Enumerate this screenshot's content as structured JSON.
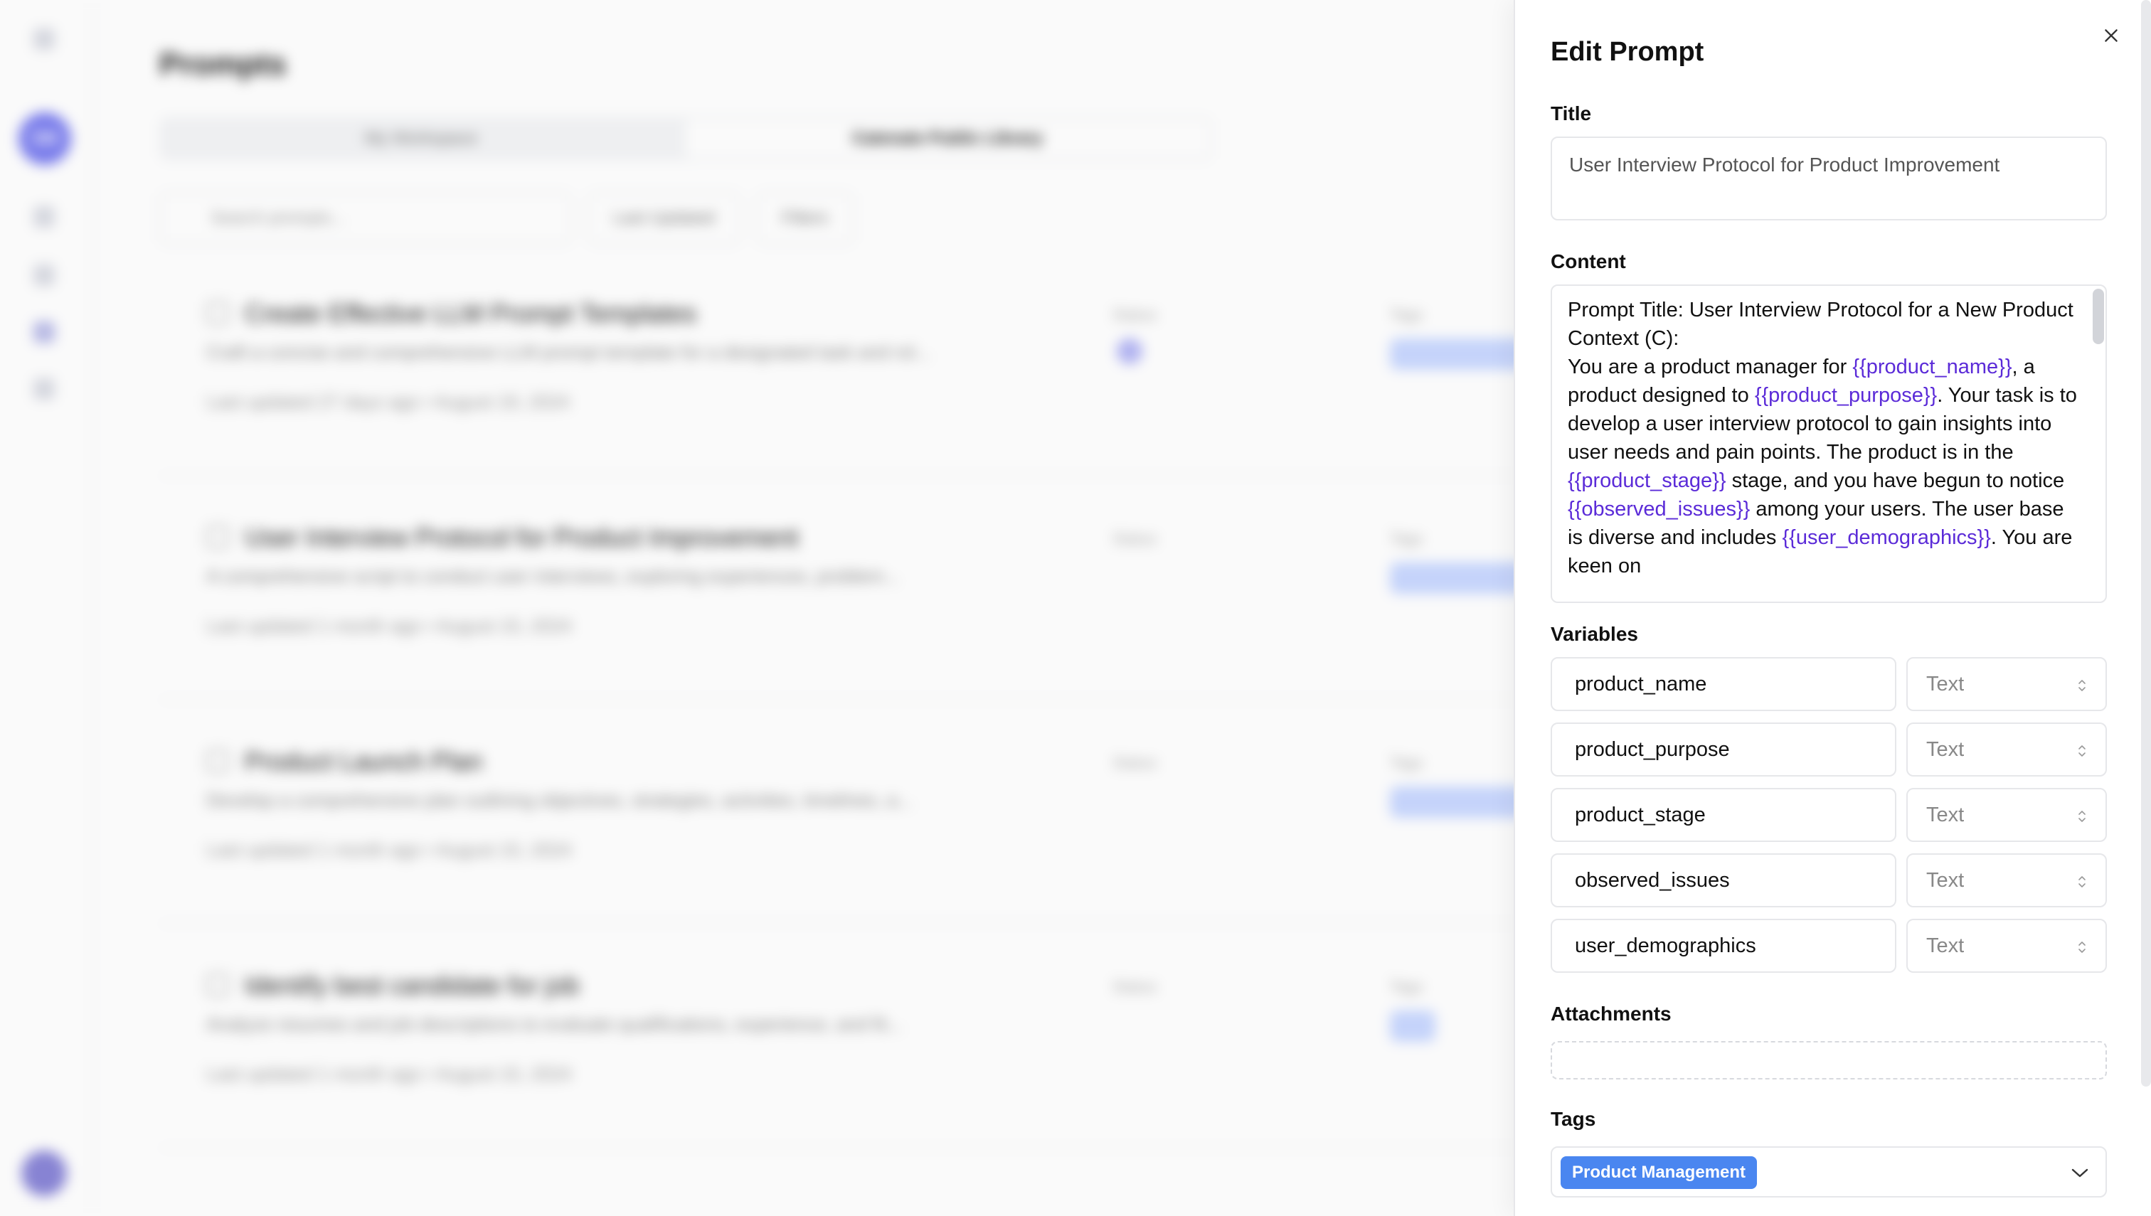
{
  "background": {
    "page_title": "Prompts",
    "avatar_initials": "SM",
    "tabs": [
      "My Workspace",
      "Catenate Public Library"
    ],
    "search_placeholder": "Search prompts...",
    "sort_label": "Last Updated",
    "filter_label": "Filters",
    "column_status": "Status",
    "column_tags": "Tags",
    "cards": [
      {
        "title": "Create Effective LLM Prompt Templates",
        "description": "Craft a concise and comprehensive LLM prompt template for a designated task and rol...",
        "meta": "Last updated 27 days ago  •  August 19, 2024"
      },
      {
        "title": "User Interview Protocol for Product Improvement",
        "description": "A comprehensive script to conduct user interviews, exploring experiences, problem...",
        "meta": "Last updated 1 month ago  •  August 15, 2024"
      },
      {
        "title": "Product Launch Plan",
        "description": "Develop a comprehensive plan outlining objectives, strategies, activities, timelines, a...",
        "meta": "Last updated 1 month ago  •  August 15, 2024"
      },
      {
        "title": "Identify best candidate for job",
        "description": "Analyze resumes and job descriptions to evaluate qualifications, experience, and fit...",
        "meta": "Last updated 1 month ago  •  August 15, 2024"
      }
    ]
  },
  "drawer": {
    "title": "Edit Prompt",
    "close_label": "×",
    "title_label": "Title",
    "title_value": "User Interview Protocol for Product Improvement",
    "content_label": "Content",
    "content_parts": [
      "Prompt Title: User Interview Protocol for a New Product",
      "Context (C):",
      "You are a product manager for ",
      "{{product_name}}",
      ", a product designed to ",
      "{{product_purpose}}",
      ". Your task is to develop a user interview protocol to gain insights into user needs and pain points. The product is in the ",
      "{{product_stage}}",
      " stage, and you have begun to notice ",
      "{{observed_issues}}",
      " among your users. The user base is diverse and includes ",
      "{{user_demographics}}",
      ". You are keen on"
    ],
    "variables_label": "Variables",
    "variables": [
      {
        "name": "product_name",
        "type": "Text"
      },
      {
        "name": "product_purpose",
        "type": "Text"
      },
      {
        "name": "product_stage",
        "type": "Text"
      },
      {
        "name": "observed_issues",
        "type": "Text"
      },
      {
        "name": "user_demographics",
        "type": "Text"
      }
    ],
    "attachments_label": "Attachments",
    "tags_label": "Tags",
    "tags": [
      "Product Management"
    ]
  },
  "colors": {
    "variable_text": "#5b2bd8",
    "tag_chip": "#4a86f0",
    "border": "#e6e7ea"
  }
}
